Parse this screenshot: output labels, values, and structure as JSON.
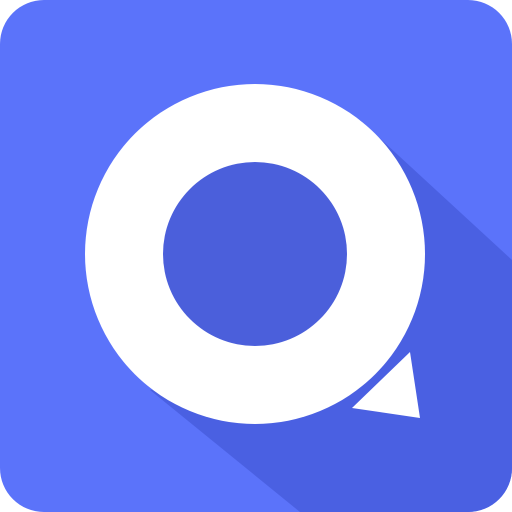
{
  "icon": {
    "name": "app-icon",
    "background_color": "#5B73FA",
    "shadow_color": "#4A5FE0",
    "ring_color": "#FFFFFF",
    "inner_color": "#4B5FDB",
    "pointer_color": "#FFFFFF"
  }
}
